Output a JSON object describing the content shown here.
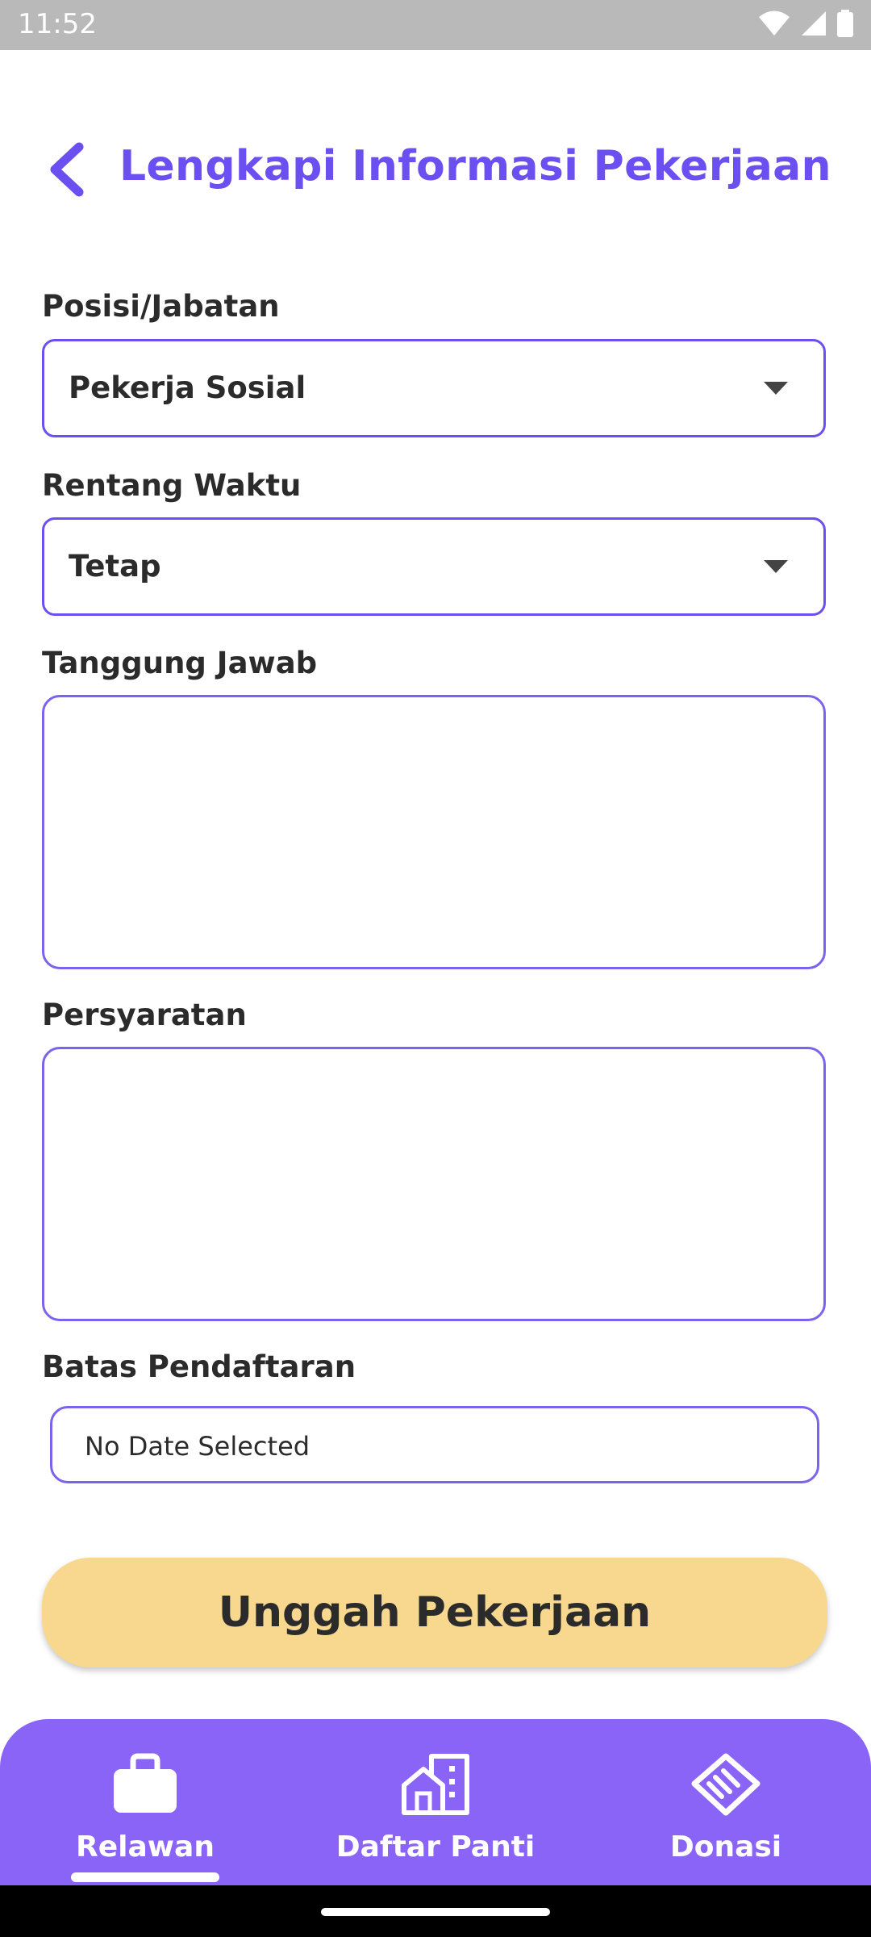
{
  "status_bar": {
    "time": "11:52"
  },
  "header": {
    "title": "Lengkapi Informasi Pekerjaan"
  },
  "form": {
    "position": {
      "label": "Posisi/Jabatan",
      "value": "Pekerja Sosial"
    },
    "time_range": {
      "label": "Rentang Waktu",
      "value": "Tetap"
    },
    "responsibility": {
      "label": "Tanggung Jawab",
      "value": ""
    },
    "requirements": {
      "label": "Persyaratan",
      "value": ""
    },
    "deadline": {
      "label": "Batas Pendaftaran",
      "value": "No Date Selected"
    },
    "submit_label": "Unggah Pekerjaan"
  },
  "bottom_nav": {
    "items": [
      {
        "label": "Relawan",
        "icon": "briefcase-icon",
        "active": true
      },
      {
        "label": "Daftar Panti",
        "icon": "building-icon",
        "active": false
      },
      {
        "label": "Donasi",
        "icon": "handshake-icon",
        "active": false
      }
    ]
  },
  "colors": {
    "accent": "#6b4ff0",
    "nav_background": "#8a63f7",
    "submit_button": "#f8d88f"
  }
}
